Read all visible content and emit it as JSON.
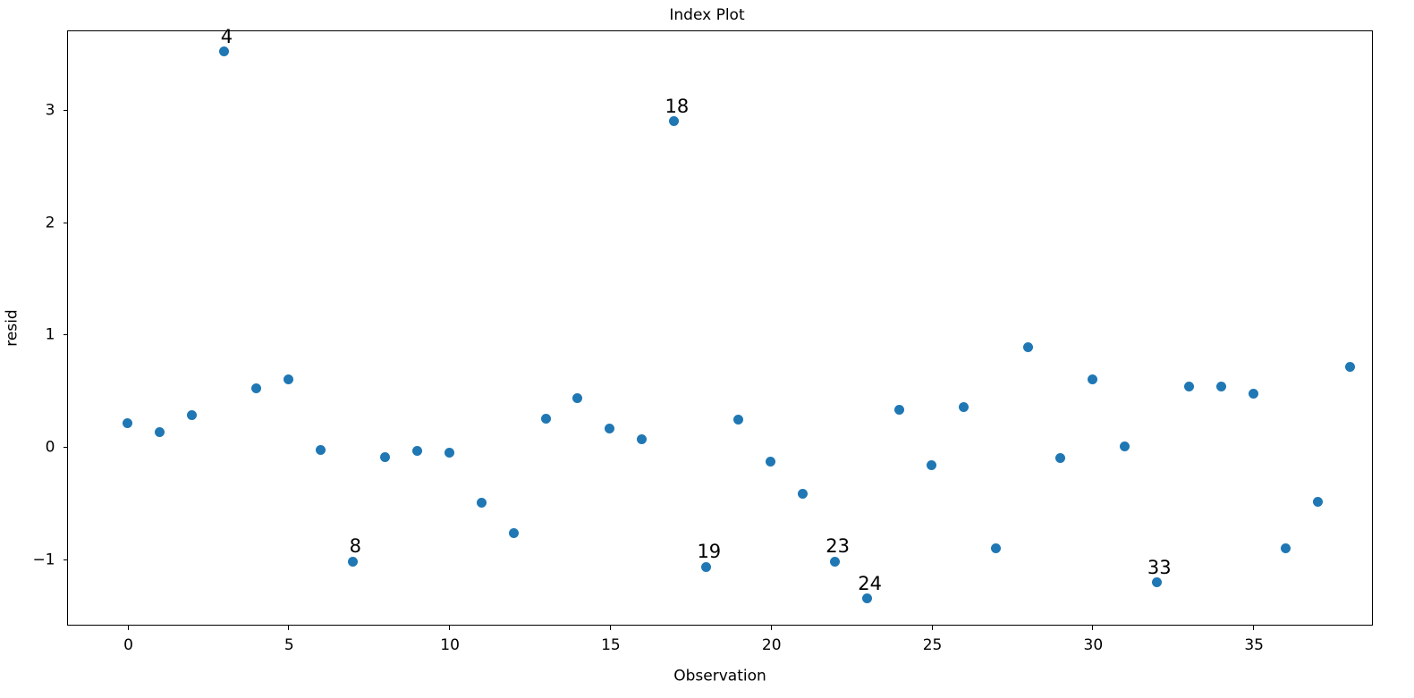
{
  "chart_data": {
    "type": "scatter",
    "title": "Index Plot",
    "xlabel": "Observation",
    "ylabel": "resid",
    "grid": false,
    "legend": null,
    "xlim": [
      -1.85,
      38.75
    ],
    "ylim": [
      -1.6,
      3.7
    ],
    "xticks": [
      0,
      5,
      10,
      15,
      20,
      25,
      30,
      35
    ],
    "yticks": [
      -1,
      0,
      1,
      2,
      3
    ],
    "xtick_labels": [
      "0",
      "5",
      "10",
      "15",
      "20",
      "25",
      "30",
      "35"
    ],
    "ytick_labels": [
      "−1",
      "0",
      "1",
      "2",
      "3"
    ],
    "marker_color": "#1f77b4",
    "series": [
      {
        "name": "resid",
        "x": [
          0,
          1,
          2,
          3,
          4,
          5,
          6,
          7,
          8,
          9,
          10,
          11,
          12,
          13,
          14,
          15,
          16,
          17,
          18,
          19,
          20,
          21,
          22,
          23,
          24,
          25,
          26,
          27,
          28,
          29,
          30,
          31,
          32,
          33,
          34,
          35,
          36,
          37,
          38
        ],
        "values": [
          0.21,
          0.13,
          0.28,
          3.52,
          0.52,
          0.6,
          -0.03,
          -1.02,
          -0.09,
          -0.04,
          -0.05,
          -0.5,
          -0.77,
          0.25,
          0.43,
          0.16,
          0.07,
          2.9,
          -1.07,
          0.24,
          -0.13,
          -0.42,
          -1.02,
          -1.35,
          0.33,
          -0.16,
          0.35,
          -0.9,
          0.89,
          -0.1,
          0.6,
          0.0,
          -1.21,
          0.54,
          0.54,
          0.47,
          -0.9,
          -0.49,
          0.71
        ]
      }
    ],
    "annotations": [
      {
        "label": "4",
        "x": 3,
        "y": 3.52
      },
      {
        "label": "8",
        "x": 7,
        "y": -1.02
      },
      {
        "label": "18",
        "x": 17,
        "y": 2.9
      },
      {
        "label": "19",
        "x": 18,
        "y": -1.07
      },
      {
        "label": "23",
        "x": 22,
        "y": -1.02
      },
      {
        "label": "24",
        "x": 23,
        "y": -1.35
      },
      {
        "label": "33",
        "x": 32,
        "y": -1.21
      }
    ]
  }
}
